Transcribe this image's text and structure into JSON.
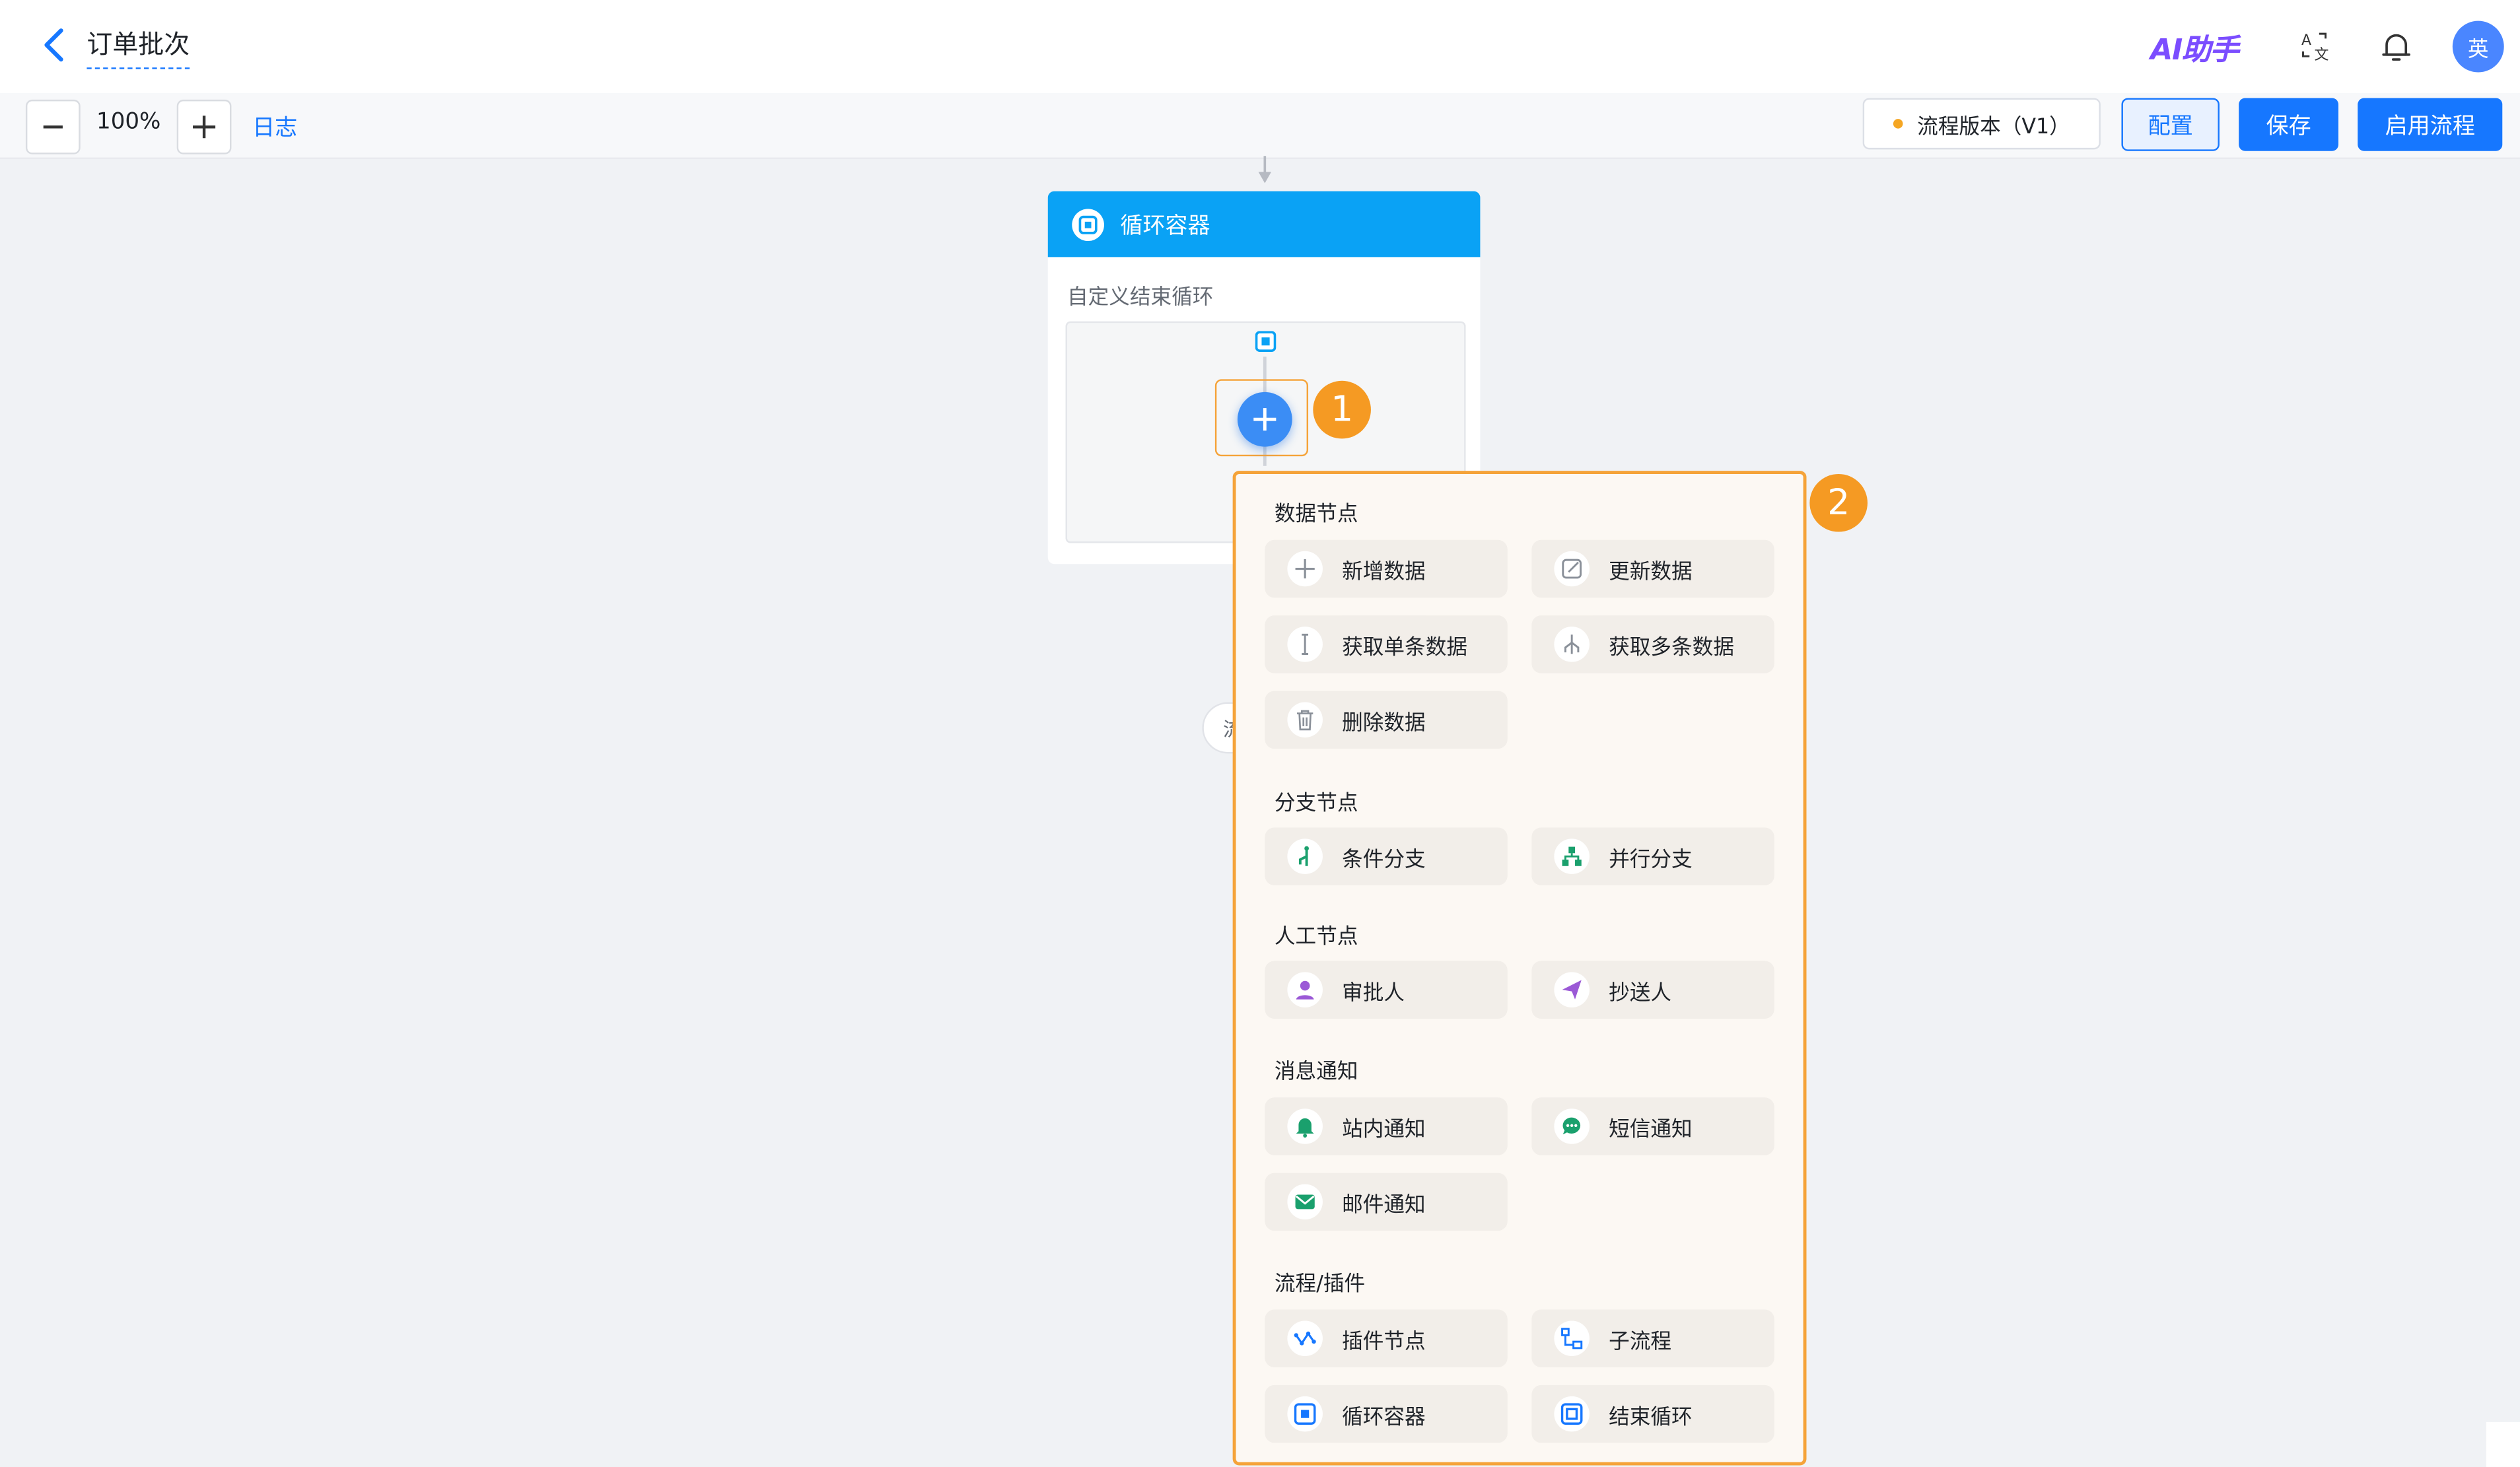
{
  "header": {
    "title": "订单批次",
    "ai_label": "AI助手",
    "avatar_text": "英"
  },
  "toolbar": {
    "zoom": "100%",
    "log_label": "日志",
    "version_label": "流程版本（V1）",
    "config_label": "配置",
    "save_label": "保存",
    "start_label": "启用流程"
  },
  "canvas": {
    "loop_title": "循环容器",
    "loop_subtitle": "自定义结束循环",
    "flow_chip": "流",
    "badge1": "1",
    "badge2": "2"
  },
  "menu": {
    "sections": [
      {
        "title": "数据节点",
        "items": [
          {
            "label": "新增数据",
            "icon": "plus-icon"
          },
          {
            "label": "更新数据",
            "icon": "edit-icon"
          },
          {
            "label": "获取单条数据",
            "icon": "single-line-icon"
          },
          {
            "label": "获取多条数据",
            "icon": "multi-branch-icon"
          },
          {
            "label": "删除数据",
            "icon": "trash-icon"
          }
        ]
      },
      {
        "title": "分支节点",
        "items": [
          {
            "label": "条件分支",
            "icon": "condition-branch-icon"
          },
          {
            "label": "并行分支",
            "icon": "parallel-branch-icon"
          }
        ]
      },
      {
        "title": "人工节点",
        "items": [
          {
            "label": "审批人",
            "icon": "user-icon"
          },
          {
            "label": "抄送人",
            "icon": "send-icon"
          }
        ]
      },
      {
        "title": "消息通知",
        "items": [
          {
            "label": "站内通知",
            "icon": "bell-icon"
          },
          {
            "label": "短信通知",
            "icon": "chat-icon"
          },
          {
            "label": "邮件通知",
            "icon": "mail-icon"
          }
        ]
      },
      {
        "title": "流程/插件",
        "items": [
          {
            "label": "插件节点",
            "icon": "plugin-icon"
          },
          {
            "label": "子流程",
            "icon": "subflow-icon"
          },
          {
            "label": "循环容器",
            "icon": "loop-container-icon"
          },
          {
            "label": "结束循环",
            "icon": "end-loop-icon"
          }
        ]
      }
    ]
  },
  "colors": {
    "primary": "#1677ff",
    "loop_header": "#0aa2f5",
    "highlight": "#f5a339",
    "badge": "#f59a23",
    "menu_bg": "#fcf8f3"
  }
}
